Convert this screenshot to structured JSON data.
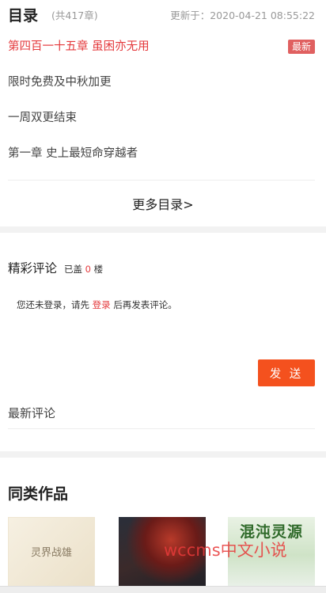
{
  "toc": {
    "title": "目录",
    "count": "(共417章)",
    "updated": "更新于：2020-04-21 08:55:22",
    "chapters": [
      {
        "label": "第四百一十五章 虽困亦无用",
        "badge": "最新"
      },
      {
        "label": "限时免费及中秋加更"
      },
      {
        "label": "一周双更结束"
      },
      {
        "label": "第一章 史上最短命穿越者"
      }
    ],
    "more_label": "更多目录>"
  },
  "comments": {
    "title": "精彩评论",
    "floors_prefix": "已盖",
    "floors_count": "0",
    "floors_suffix": "楼",
    "login_prefix": "您还未登录，请先",
    "login_link": "登录",
    "login_suffix": "后再发表评论。",
    "send_label": "发 送",
    "latest_label": "最新评论"
  },
  "similar": {
    "title": "同类作品",
    "covers": [
      {
        "cover_text": "灵界战雄"
      },
      {
        "cover_text": ""
      },
      {
        "cover_text": "混沌灵源"
      }
    ],
    "watermark": "wccms中文小说"
  },
  "colors": {
    "accent_red": "#e4393c",
    "send_button": "#f4511e",
    "badge": "#e06060"
  }
}
